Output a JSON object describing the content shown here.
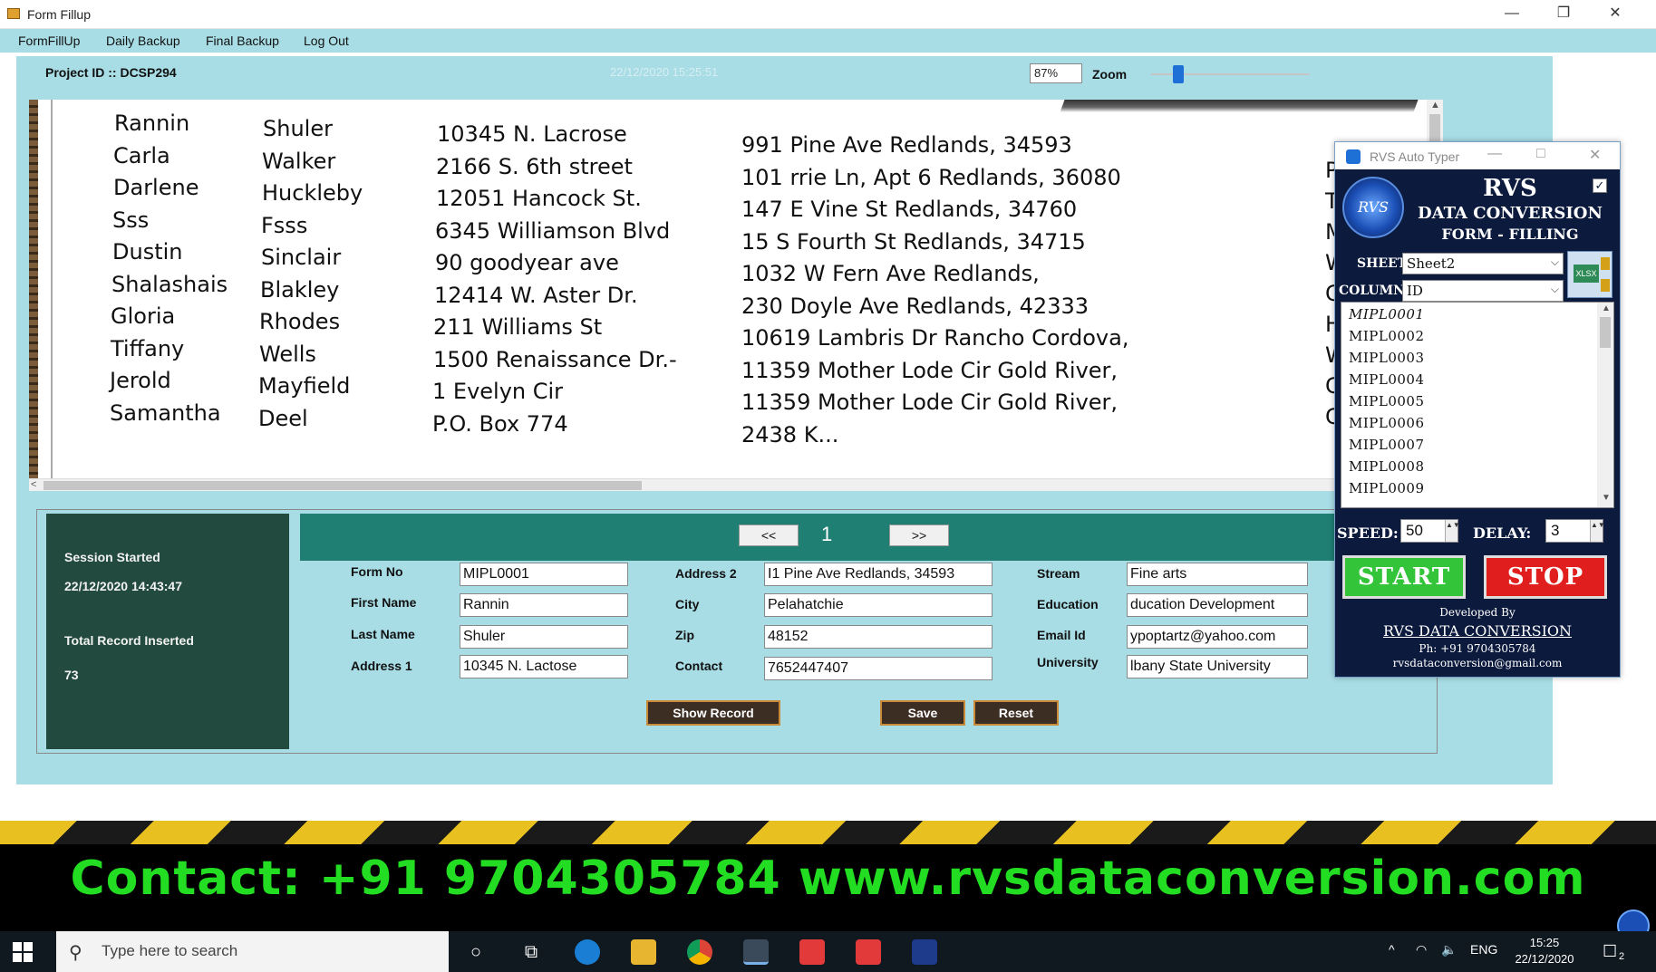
{
  "window": {
    "title": "Form Fillup",
    "minimize": "—",
    "restore": "❐",
    "close": "✕"
  },
  "menu": [
    "FormFillUp",
    "Daily Backup",
    "Final Backup",
    "Log Out"
  ],
  "header": {
    "project_label": "Project ID ::  DCSP294",
    "datetime": "22/12/2020 15:25:51",
    "zoom_value": "87%",
    "zoom_label": "Zoom",
    "zoom_level_percent": 87
  },
  "document": {
    "col_first": [
      "Rannin",
      "Carla",
      "Darlene",
      "Sss",
      "Dustin",
      "Shalashais",
      "Gloria",
      "Tiffany",
      "Jerold",
      "Samantha"
    ],
    "col_last": [
      "Shuler",
      "Walker",
      "Huckleby",
      "Fsss",
      "Sinclair",
      "Blakley",
      "Rhodes",
      "Wells",
      "Mayfield",
      "Deel"
    ],
    "col_address1": [
      "10345 N. Lacrose",
      "2166 S. 6th street",
      "12051 Hancock St.",
      "6345 Williamson Blvd",
      "90 goodyear ave",
      "12414 W. Aster Dr.",
      "211 Williams St",
      "1500 Renaissance Dr.-",
      "1 Evelyn Cir",
      "P.O. Box 774"
    ],
    "col_address2": [
      "991 Pine Ave Redlands,  34593",
      "101 rrie Ln, Apt 6 Redlands,  36080",
      "147 E Vine St Redlands,  34760",
      "15 S Fourth St Redlands,  34715",
      "1032 W Fern Ave Redlands,",
      "230 Doyle Ave Redlands,  42333",
      "10619 Lambris Dr Rancho Cordova,",
      "11359 Mother Lode Cir Gold River,",
      "11359 Mother Lode Cir Gold River,",
      "2438 K..."
    ],
    "col_city_partial": [
      "Pe",
      "Tu",
      "Me",
      "Wy",
      "Ca",
      "Hu",
      "Wo",
      "Gr",
      "Gr"
    ]
  },
  "session": {
    "started_label": "Session Started",
    "started_value": "22/12/2020 14:43:47",
    "total_label": "Total Record Inserted",
    "total_value": "73"
  },
  "nav": {
    "prev": "<<",
    "page": "1",
    "next": ">>"
  },
  "form": {
    "form_no_label": "Form No",
    "form_no": "MIPL0001",
    "first_name_label": "First  Name",
    "first_name": "Rannin",
    "last_name_label": "Last Name",
    "last_name": "Shuler",
    "address1_label": "Address 1",
    "address1": "10345 N. Lactose",
    "address2_label": "Address 2",
    "address2": "I1 Pine Ave Redlands, 34593",
    "city_label": "City",
    "city": "Pelahatchie",
    "zip_label": "Zip",
    "zip": "48152",
    "contact_label": "Contact",
    "contact": "7652447407",
    "stream_label": "Stream",
    "stream": "Fine arts",
    "education_label": "Education",
    "education": "ducation Development",
    "email_label": "Email Id",
    "email": "ypoptartz@yahoo.com",
    "university_label": "University",
    "university": "lbany State University",
    "show_record": "Show Record",
    "save": "Save",
    "reset": "Reset"
  },
  "rvs": {
    "window_title": "RVS Auto Typer",
    "minimize": "—",
    "maximize": "□",
    "close": "✕",
    "logo": "RVS",
    "heading1": "RVS",
    "heading2": "DATA CONVERSION",
    "heading3": "FORM - FILLING",
    "checkbox": "✓",
    "sheet_label": "SHEET:",
    "sheet_value": "Sheet2",
    "column_label": "COLUMN:",
    "column_value": "ID",
    "dropdown_glyph": "⌵",
    "xls_label": "XLSX",
    "list": [
      "MIPL0001",
      "MIPL0002",
      "MIPL0003",
      "MIPL0004",
      "MIPL0005",
      "MIPL0006",
      "MIPL0007",
      "MIPL0008",
      "MIPL0009"
    ],
    "list_up": "▲",
    "list_down": "▼",
    "speed_label": "SPEED:",
    "speed_value": "50",
    "delay_label": "DELAY:",
    "delay_value": "3",
    "spin_arrows": "▲▼",
    "start": "START",
    "stop": "STOP",
    "developed_by": "Developed By",
    "company": "RVS DATA CONVERSION",
    "phone": "Ph: +91 9704305784",
    "email": "rvsdataconversion@gmail.com"
  },
  "banner": {
    "text": "Contact: +91 9704305784 www.rvsdataconversion.com"
  },
  "taskbar": {
    "search_icon": "⚲",
    "search_placeholder": "Type here to search",
    "cortana": "○",
    "taskview": "⧉",
    "tray_up": "^",
    "wifi": "◠",
    "volume": "🔈",
    "lang": "ENG",
    "time": "15:25",
    "date": "22/12/2020",
    "notify": "☐",
    "notify_count": "2"
  },
  "colors": {
    "teal": "#a8dde6",
    "session_bg": "#234a3e",
    "nav_bg": "#1f7f73",
    "rvs_bg": "#0c1a3d",
    "start_green": "#33c43a",
    "stop_red": "#e01e1e",
    "banner_green": "#22dd22"
  }
}
